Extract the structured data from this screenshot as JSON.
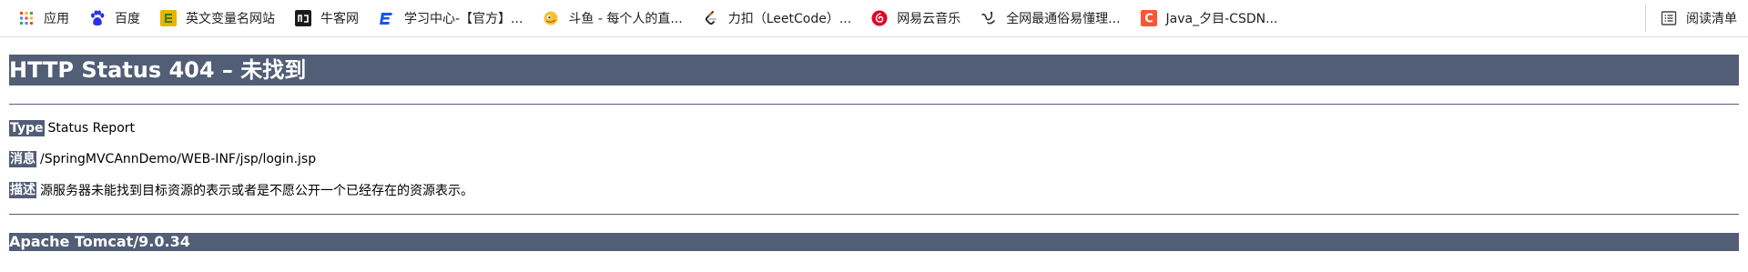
{
  "bookmarks": {
    "items": [
      {
        "label": "应用",
        "icon": "apps-grid-icon"
      },
      {
        "label": "百度",
        "icon": "baidu-paw-icon"
      },
      {
        "label": "英文变量名网站",
        "icon": "codelf-icon"
      },
      {
        "label": "牛客网",
        "icon": "nowcoder-icon"
      },
      {
        "label": "学习中心-【官方】...",
        "icon": "learning-center-icon"
      },
      {
        "label": "斗鱼 - 每个人的直...",
        "icon": "douyu-icon"
      },
      {
        "label": "力扣（LeetCode）...",
        "icon": "leetcode-icon"
      },
      {
        "label": "网易云音乐",
        "icon": "netease-music-icon"
      },
      {
        "label": "全网最通俗易懂理...",
        "icon": "article-icon"
      },
      {
        "label": "Java_夕目-CSDN...",
        "icon": "csdn-icon"
      }
    ],
    "reading_list": {
      "label": "阅读清单",
      "icon": "reading-list-icon"
    }
  },
  "error_page": {
    "title": "HTTP Status 404 – 未找到",
    "type_label": "Type",
    "type_value": "Status Report",
    "message_label": "消息",
    "message_value": "/SpringMVCAnnDemo/WEB-INF/jsp/login.jsp",
    "description_label": "描述",
    "description_value": "源服务器未能找到目标资源的表示或者是不愿公开一个已经存在的资源表示。",
    "footer": "Apache Tomcat/9.0.34"
  },
  "colors": {
    "tomcat_header": "#525d76"
  }
}
